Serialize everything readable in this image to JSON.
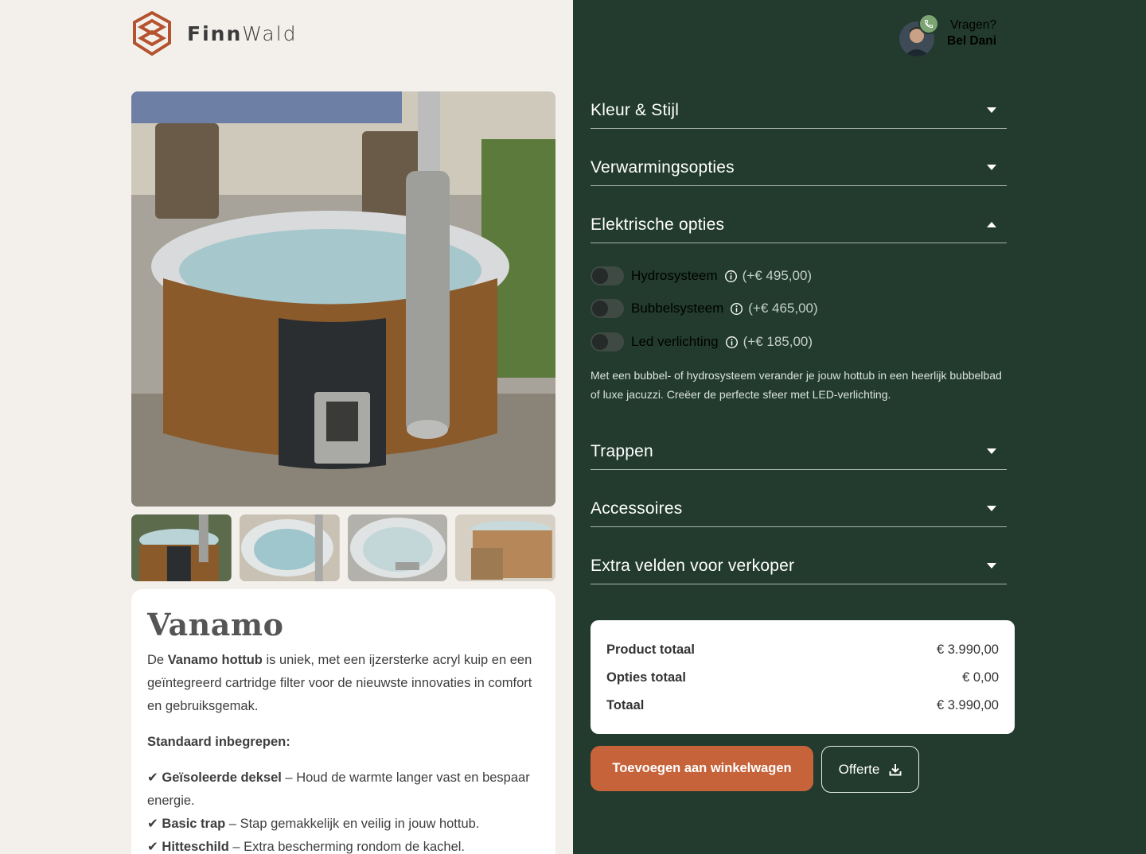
{
  "brand": {
    "name_bold": "Finn",
    "name_light": "Wald"
  },
  "contact": {
    "question": "Vragen?",
    "name": "Bel Dani"
  },
  "accordions": [
    {
      "title": "Kleur & Stijl",
      "state": "collapsed"
    },
    {
      "title": "Verwarmingsopties",
      "state": "collapsed"
    },
    {
      "title": "Elektrische opties",
      "state": "expanded"
    },
    {
      "title": "Trappen",
      "state": "collapsed"
    },
    {
      "title": "Accessoires",
      "state": "collapsed"
    },
    {
      "title": "Extra velden voor verkoper",
      "state": "collapsed"
    }
  ],
  "electric_options": [
    {
      "label": "Hydrosysteem",
      "price": "(+€ 495,00)",
      "enabled": false
    },
    {
      "label": "Bubbelsysteem",
      "price": "(+€ 465,00)",
      "enabled": false
    },
    {
      "label": "Led verlichting",
      "price": "(+€ 185,00)",
      "enabled": false
    }
  ],
  "electric_description": "Met een bubbel- of hydrosysteem verander je jouw hottub in een heerlijk bubbelbad of luxe jacuzzi. Creëer de perfecte sfeer met LED-verlichting.",
  "product": {
    "name": "Vanamo",
    "intro_prefix": "De ",
    "intro_bold": "Vanamo hottub",
    "intro_rest": " is uniek, met een ijzersterke acryl kuip en een geïntegreerd cartridge filter voor de nieuwste innovaties in comfort en gebruiksgemak.",
    "standard_heading": "Standaard inbegrepen:",
    "features": [
      {
        "check": "✔",
        "bold": "Geïsoleerde deksel",
        "text": " – Houd de warmte langer vast en bespaar energie."
      },
      {
        "check": "✔",
        "bold": "Basic trap",
        "text": " – Stap gemakkelijk en veilig in jouw hottub."
      },
      {
        "check": "✔",
        "bold": "Hitteschild",
        "text": " – Extra bescherming rondom de kachel."
      }
    ]
  },
  "totals": {
    "product_label": "Product totaal",
    "product_value": "€ 3.990,00",
    "options_label": "Opties totaal",
    "options_value": "€ 0,00",
    "total_label": "Totaal",
    "total_value": "€ 3.990,00"
  },
  "buttons": {
    "cart": "Toevoegen aan winkelwagen",
    "offerte": "Offerte"
  },
  "colors": {
    "panel": "#223b2e",
    "accent": "#c6633a",
    "left_bg": "#f3f0ec",
    "logo": "#b5522f"
  }
}
